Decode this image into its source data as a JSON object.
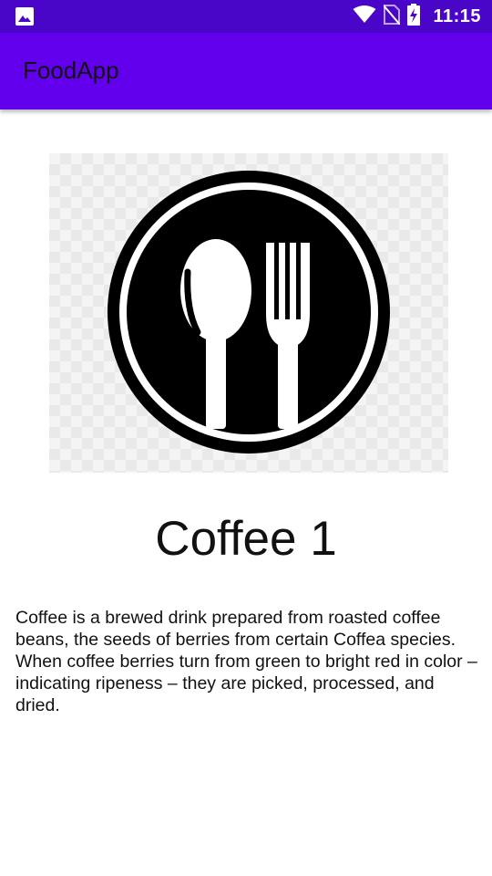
{
  "status_bar": {
    "time": "11:15",
    "icons": [
      "gallery-icon",
      "wifi-icon",
      "no-sim-icon",
      "battery-charging-icon"
    ]
  },
  "app_bar": {
    "title": "FoodApp",
    "background_color": "#6200ee"
  },
  "item": {
    "image_icon": "plate-spoon-fork-icon",
    "title": "Coffee 1",
    "description": "Coffee is a brewed drink prepared from roasted coffee beans, the seeds of berries from certain Coffea species. When coffee berries turn from green to bright red in color – indicating ripeness – they are picked, processed, and dried."
  }
}
